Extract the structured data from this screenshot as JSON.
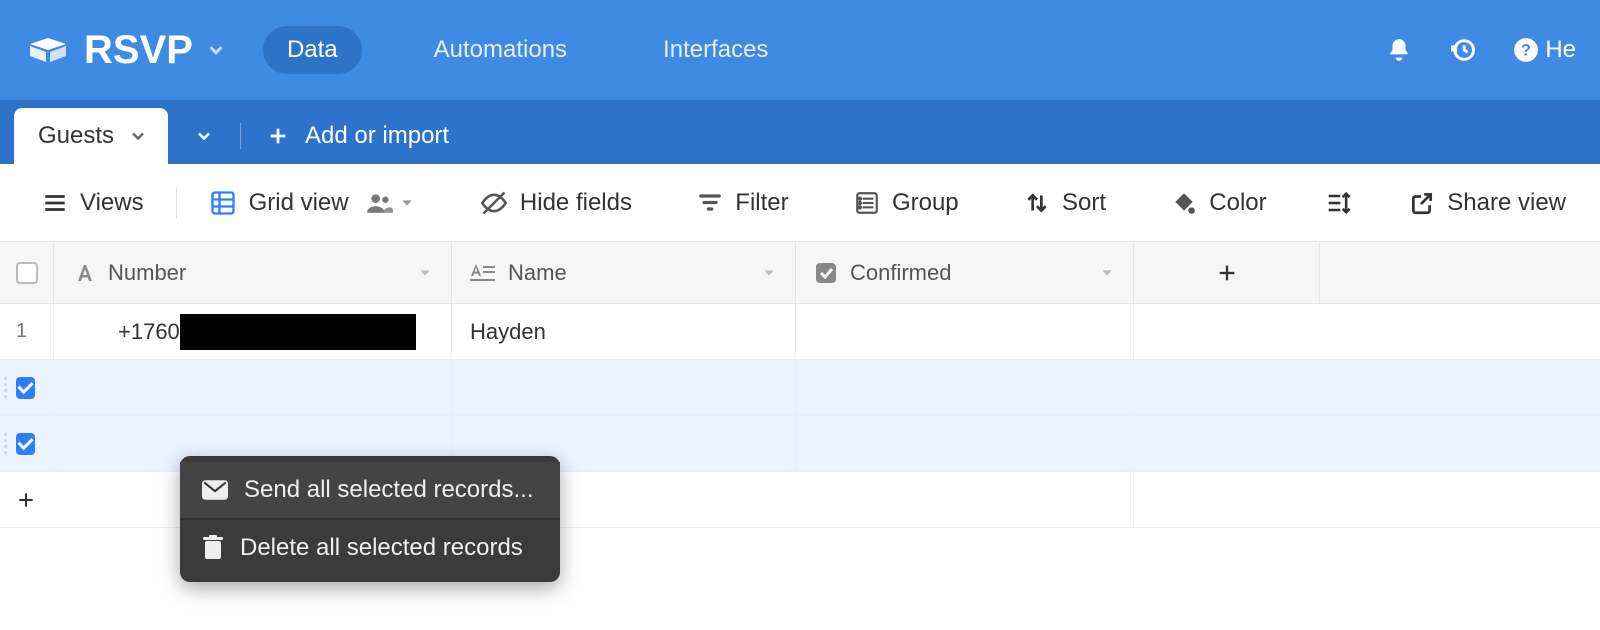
{
  "header": {
    "base_name": "RSVP",
    "tabs": {
      "data": "Data",
      "automations": "Automations",
      "interfaces": "Interfaces"
    },
    "help_prefix": "He"
  },
  "tables": {
    "active": "Guests",
    "add_or_import": "Add or import"
  },
  "toolbar": {
    "views": "Views",
    "grid_view": "Grid view",
    "hide_fields": "Hide fields",
    "filter": "Filter",
    "group": "Group",
    "sort": "Sort",
    "color": "Color",
    "share_view": "Share view"
  },
  "fields": {
    "number": "Number",
    "name": "Name",
    "confirmed": "Confirmed"
  },
  "rows": [
    {
      "num": "1",
      "number_prefix": "+1760",
      "name": "Hayden",
      "confirmed": "",
      "selected": false
    },
    {
      "num": "",
      "number_prefix": "",
      "name": "",
      "confirmed": "",
      "selected": true
    },
    {
      "num": "",
      "number_prefix": "",
      "name": "",
      "confirmed": "",
      "selected": true
    }
  ],
  "context_menu": {
    "send": "Send all selected records...",
    "delete": "Delete all selected records"
  }
}
